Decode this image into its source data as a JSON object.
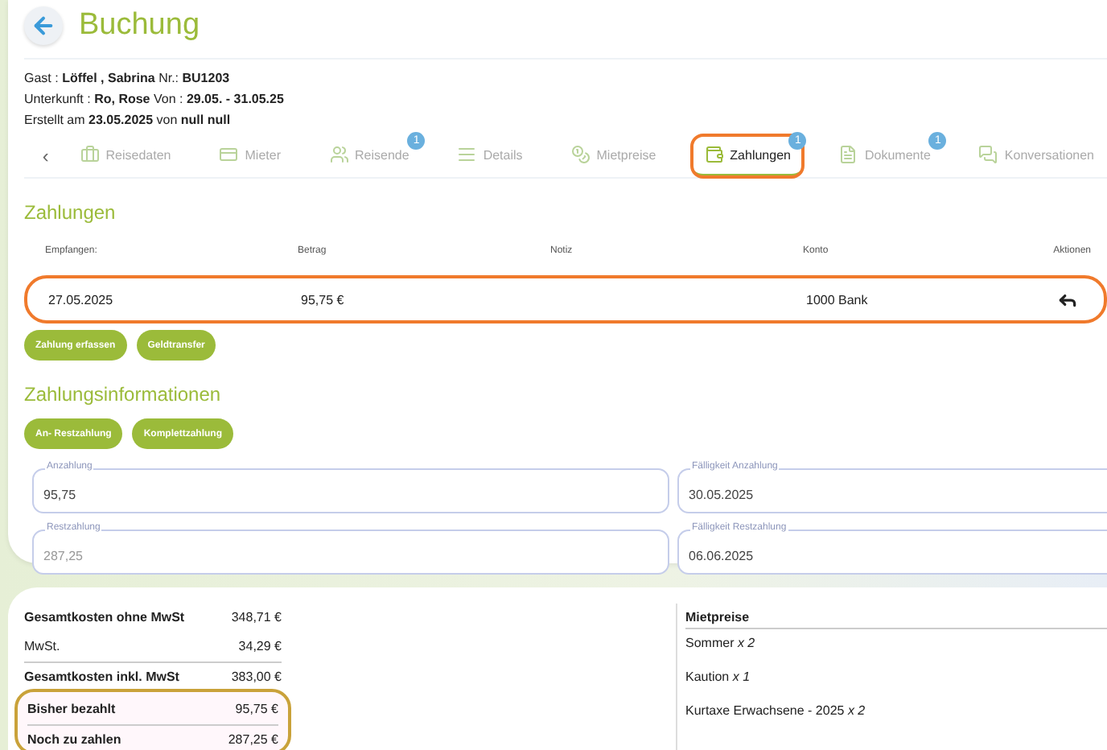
{
  "header": {
    "title": "Buchung"
  },
  "info_lines": [
    "Gast : **Löffel , Sabrina** Nr.: **BU1203**",
    "Unterkunft : **Ro, Rose** Von : **29.05. - 31.05.25**",
    "Erstellt am **23.05.2025** von **null null**"
  ],
  "tabs_prev": "‹",
  "tabs": [
    {
      "label": "Reisedaten",
      "selected": false,
      "highlighted": false
    },
    {
      "label": "Mieter",
      "selected": false,
      "highlighted": false
    },
    {
      "label": "Reisende",
      "selected": false,
      "badge": "1",
      "highlighted": false
    },
    {
      "label": "Details",
      "selected": false,
      "highlighted": false
    },
    {
      "label": "Mietpreise",
      "selected": false,
      "highlighted": false
    },
    {
      "label": "Zahlungen",
      "selected": true,
      "badge": "1",
      "highlighted": true
    },
    {
      "label": "Dokumente",
      "selected": false,
      "badge": "1",
      "highlighted": false
    },
    {
      "label": "Konversationen",
      "selected": false,
      "highlighted": false
    }
  ],
  "payments": {
    "title": "Zahlungen",
    "columns": [
      "Empfangen:",
      "Betrag",
      "Notiz",
      "Konto",
      "Aktionen"
    ],
    "rows": [
      {
        "received": "27.05.2025",
        "amount": "95,75 €",
        "note": "",
        "account": "1000 Bank",
        "highlighted": true
      }
    ],
    "buttons": [
      "Zahlung erfassen",
      "Geldtransfer"
    ]
  },
  "payment_info": {
    "title": "Zahlungsinformationen",
    "buttons": [
      "An- Restzahlung",
      "Komplettzahlung"
    ],
    "fields": [
      {
        "label": "Anzahlung",
        "value": "95,75",
        "disabled": false
      },
      {
        "label": "Fälligkeit Anzahlung",
        "value": "30.05.2025",
        "disabled": false
      },
      {
        "label": "Restzahlung",
        "value": "287,25",
        "disabled": true
      },
      {
        "label": "Fälligkeit Restzahlung",
        "value": "06.06.2025",
        "disabled": false
      }
    ]
  },
  "summary": [
    {
      "label": "Gesamtkosten ohne MwSt",
      "value": "348,71 €",
      "divider": false,
      "highlighted": false
    },
    {
      "label": "MwSt.",
      "value": "34,29 €",
      "divider": true,
      "highlighted": false
    },
    {
      "label": "Gesamtkosten inkl. MwSt",
      "value": "383,00 €",
      "divider": false,
      "highlighted": false
    },
    {
      "label": "Bisher bezahlt",
      "value": "95,75 €",
      "divider": true,
      "highlighted": true
    },
    {
      "label": "Noch zu zahlen",
      "value": "287,25 €",
      "divider": false,
      "highlighted": true
    }
  ],
  "rental_prices": {
    "title": "Mietpreise",
    "items": [
      "Sommer *x 2*",
      "Kaution *x 1*",
      "Kurtaxe Erwachsene - 2025 *x 2*"
    ]
  }
}
